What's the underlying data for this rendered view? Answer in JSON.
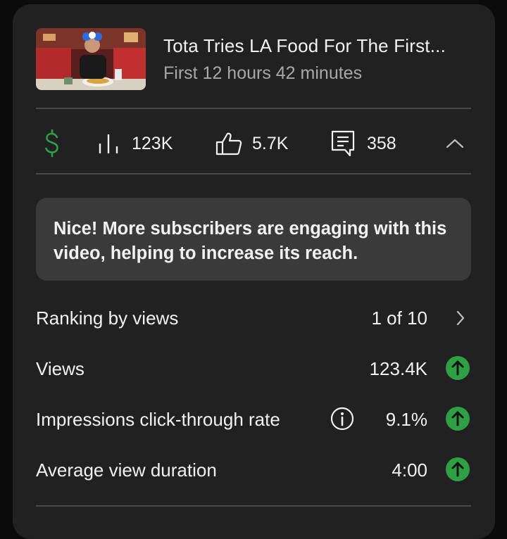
{
  "video": {
    "title": "Tota Tries LA Food For The First...",
    "subtitle": "First 12 hours 42 minutes"
  },
  "stats": {
    "views": "123K",
    "likes": "5.7K",
    "comments": "358"
  },
  "banner": {
    "text": "Nice! More subscribers are engaging with this video, helping to increase its reach."
  },
  "metrics": [
    {
      "label": "Ranking by views",
      "value": "1 of 10",
      "indicator": "chevron-right"
    },
    {
      "label": "Views",
      "value": "123.4K",
      "indicator": "up-arrow"
    },
    {
      "label": "Impressions click-through rate",
      "value": "9.1%",
      "indicator": "up-arrow",
      "info": true
    },
    {
      "label": "Average view duration",
      "value": "4:00",
      "indicator": "up-arrow"
    }
  ],
  "colors": {
    "card_bg": "#212121",
    "banner_bg": "#3a3a3a",
    "monetization_green": "#2ea043",
    "secondary_text": "#a8a8a8"
  }
}
